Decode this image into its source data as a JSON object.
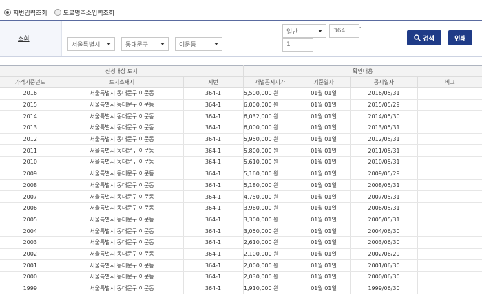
{
  "search_mode": {
    "options": [
      {
        "label": "지번입력조회",
        "checked": true
      },
      {
        "label": "도로명주소입력조회",
        "checked": false
      }
    ]
  },
  "search": {
    "label": "조회",
    "sido": "서울특별시",
    "sigungu": "동대문구",
    "dong": "이문동",
    "land_type": "일반",
    "bonbun": "364",
    "dash": "-",
    "bubun": "1",
    "search_button": "검색",
    "print_button": "인쇄"
  },
  "table": {
    "group_headers": [
      "신청대상 토지",
      "확인내용"
    ],
    "columns": [
      "가격기준년도",
      "토지소재지",
      "지번",
      "개별공시지가",
      "기준일자",
      "공시일자",
      "비고"
    ],
    "rows": [
      [
        "2016",
        "서울특별시 동대문구 이문동",
        "364-1",
        "5,500,000 원",
        "01월 01일",
        "2016/05/31",
        ""
      ],
      [
        "2015",
        "서울특별시 동대문구 이문동",
        "364-1",
        "6,000,000 원",
        "01월 01일",
        "2015/05/29",
        ""
      ],
      [
        "2014",
        "서울특별시 동대문구 이문동",
        "364-1",
        "6,032,000 원",
        "01월 01일",
        "2014/05/30",
        ""
      ],
      [
        "2013",
        "서울특별시 동대문구 이문동",
        "364-1",
        "6,000,000 원",
        "01월 01일",
        "2013/05/31",
        ""
      ],
      [
        "2012",
        "서울특별시 동대문구 이문동",
        "364-1",
        "5,950,000 원",
        "01월 01일",
        "2012/05/31",
        ""
      ],
      [
        "2011",
        "서울특별시 동대문구 이문동",
        "364-1",
        "5,800,000 원",
        "01월 01일",
        "2011/05/31",
        ""
      ],
      [
        "2010",
        "서울특별시 동대문구 이문동",
        "364-1",
        "5,610,000 원",
        "01월 01일",
        "2010/05/31",
        ""
      ],
      [
        "2009",
        "서울특별시 동대문구 이문동",
        "364-1",
        "5,160,000 원",
        "01월 01일",
        "2009/05/29",
        ""
      ],
      [
        "2008",
        "서울특별시 동대문구 이문동",
        "364-1",
        "5,180,000 원",
        "01월 01일",
        "2008/05/31",
        ""
      ],
      [
        "2007",
        "서울특별시 동대문구 이문동",
        "364-1",
        "4,750,000 원",
        "01월 01일",
        "2007/05/31",
        ""
      ],
      [
        "2006",
        "서울특별시 동대문구 이문동",
        "364-1",
        "3,960,000 원",
        "01월 01일",
        "2006/05/31",
        ""
      ],
      [
        "2005",
        "서울특별시 동대문구 이문동",
        "364-1",
        "3,300,000 원",
        "01월 01일",
        "2005/05/31",
        ""
      ],
      [
        "2004",
        "서울특별시 동대문구 이문동",
        "364-1",
        "3,050,000 원",
        "01월 01일",
        "2004/06/30",
        ""
      ],
      [
        "2003",
        "서울특별시 동대문구 이문동",
        "364-1",
        "2,610,000 원",
        "01월 01일",
        "2003/06/30",
        ""
      ],
      [
        "2002",
        "서울특별시 동대문구 이문동",
        "364-1",
        "2,100,000 원",
        "01월 01일",
        "2002/06/29",
        ""
      ],
      [
        "2001",
        "서울특별시 동대문구 이문동",
        "364-1",
        "2,000,000 원",
        "01월 01일",
        "2001/06/30",
        ""
      ],
      [
        "2000",
        "서울특별시 동대문구 이문동",
        "364-1",
        "2,030,000 원",
        "01월 01일",
        "2000/06/30",
        ""
      ],
      [
        "1999",
        "서울특별시 동대문구 이문동",
        "364-1",
        "1,910,000 원",
        "01월 01일",
        "1999/06/30",
        ""
      ]
    ]
  },
  "colors": {
    "button_primary": "#1f3b87",
    "search_border": "#5a6ba0",
    "header_bg": "#f3f3f3"
  },
  "icons": {
    "search_button_icon": "search-icon",
    "dropdown_icon": "chevron-down-icon"
  }
}
